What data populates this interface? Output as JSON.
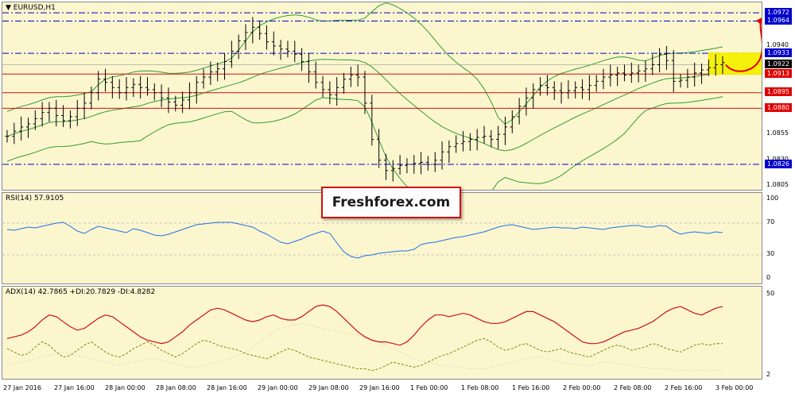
{
  "colors": {
    "bg": "#fcf6cf",
    "candle": "#000000",
    "bollinger": "#2e9e2e",
    "res_line": "#d01010",
    "blue_line": "#0000cc",
    "rsi": "#1e72e8",
    "adx": "#d01010",
    "plus_di": "#7a8a00",
    "minus_di": "#e0dcae",
    "highlight": "#f6f000",
    "arrow": "#e00000",
    "tag_blue": "#0000cc",
    "tag_red": "#e00000",
    "tag_black": "#000000"
  },
  "main": {
    "title": "▼ EURUSD,H1"
  },
  "rsi": {
    "title": "RSI(14) 57.9105",
    "ticks": [
      "100",
      "70",
      "30",
      "0"
    ]
  },
  "adx": {
    "title": "ADX(14) 42.7865 +DI:20.7829 -DI:4.8282",
    "ticks": [
      "50",
      "2"
    ]
  },
  "brand": {
    "label": "Freshforex.com"
  },
  "chart_data": [
    {
      "type": "line",
      "title": "EURUSD,H1",
      "x": [
        "27 Jan 2016",
        "27 Jan 16:00",
        "28 Jan 00:00",
        "28 Jan 08:00",
        "28 Jan 16:00",
        "29 Jan 00:00",
        "29 Jan 08:00",
        "29 Jan 16:00",
        "1 Feb 00:00",
        "1 Feb 08:00",
        "1 Feb 16:00",
        "2 Feb 00:00",
        "2 Feb 08:00",
        "2 Feb 16:00",
        "3 Feb 00:00"
      ],
      "ylim": [
        1.08,
        1.0982
      ],
      "price_ticks": [
        "1.0940",
        "1.0855",
        "1.0830",
        "1.0805"
      ],
      "levels": [
        {
          "value": 1.0972,
          "label": "1.0972",
          "style": "blue-dashdot"
        },
        {
          "value": 1.0964,
          "label": "1.0964",
          "style": "blue-dashdot"
        },
        {
          "value": 1.0933,
          "label": "1.0933",
          "style": "blue-dashdot"
        },
        {
          "value": 1.0922,
          "label": "1.0922",
          "style": "current-price"
        },
        {
          "value": 1.0913,
          "label": "1.0913",
          "style": "red-solid"
        },
        {
          "value": 1.0895,
          "label": "1.0895",
          "style": "red-solid"
        },
        {
          "value": 1.088,
          "label": "1.0880",
          "style": "red-solid"
        },
        {
          "value": 1.0826,
          "label": "1.0826",
          "style": "blue-dashdot"
        }
      ],
      "series": [
        {
          "values": [
            1.0853,
            1.0858,
            1.0862,
            1.0865,
            1.087,
            1.0876,
            1.088,
            1.0873,
            1.0868,
            1.0872,
            1.088,
            1.0885,
            1.0895,
            1.0908,
            1.0905,
            1.09,
            1.0895,
            1.09,
            1.0903,
            1.09,
            1.0898,
            1.0895,
            1.089,
            1.0886,
            1.0883,
            1.0888,
            1.0895,
            1.0905,
            1.091,
            1.0915,
            1.0918,
            1.0925,
            1.0935,
            1.0945,
            1.0953,
            1.0958,
            1.0952,
            1.0944,
            1.094,
            1.0937,
            1.0935,
            1.0932,
            1.0925,
            1.0915,
            1.0905,
            1.0898,
            1.0893,
            1.09,
            1.0908,
            1.0912,
            1.091,
            1.0885,
            1.085,
            1.083,
            1.082,
            1.0822,
            1.0825,
            1.0826,
            1.0827,
            1.0828,
            1.0826,
            1.083,
            1.0838,
            1.0843,
            1.0846,
            1.0848,
            1.085,
            1.0852,
            1.0853,
            1.085,
            1.0855,
            1.0862,
            1.0872,
            1.0882,
            1.089,
            1.0898,
            1.0902,
            1.09,
            1.0897,
            1.0895,
            1.0897,
            1.09,
            1.0898,
            1.0902,
            1.0906,
            1.091,
            1.0912,
            1.0914,
            1.0912,
            1.0914,
            1.0916,
            1.0918,
            1.0922,
            1.0932,
            1.0926,
            1.0906,
            1.0907,
            1.091,
            1.0914,
            1.0917,
            1.0919,
            1.0922,
            1.0924
          ]
        },
        {
          "name": "RSI(14)",
          "values": [
            62,
            61,
            63,
            65,
            64,
            66,
            68,
            70,
            71,
            66,
            60,
            57,
            62,
            66,
            64,
            62,
            60,
            58,
            63,
            61,
            58,
            55,
            54,
            56,
            59,
            62,
            65,
            68,
            69,
            70,
            71,
            71,
            71,
            69,
            67,
            65,
            60,
            56,
            51,
            46,
            44,
            47,
            50,
            54,
            57,
            60,
            57,
            45,
            34,
            28,
            26,
            29,
            30,
            32,
            33,
            34,
            35,
            35,
            37,
            43,
            45,
            46,
            48,
            50,
            52,
            53,
            55,
            57,
            59,
            62,
            65,
            67,
            68,
            66,
            64,
            62,
            63,
            64,
            65,
            64,
            64,
            63,
            65,
            64,
            63,
            62,
            64,
            65,
            66,
            67,
            67,
            65,
            65,
            67,
            66,
            60,
            56,
            58,
            59,
            58,
            57,
            59,
            58
          ]
        },
        {
          "name": "ADX(14)",
          "values": [
            24,
            25,
            26,
            28,
            31,
            35,
            38,
            37,
            34,
            31,
            29,
            30,
            33,
            36,
            38,
            37,
            34,
            31,
            28,
            25,
            23,
            22,
            21,
            22,
            25,
            28,
            32,
            35,
            38,
            41,
            42,
            41,
            39,
            37,
            35,
            34,
            35,
            37,
            38,
            36,
            35,
            35,
            37,
            40,
            43,
            44,
            43,
            40,
            36,
            32,
            28,
            25,
            23,
            22,
            22,
            21,
            20,
            22,
            26,
            31,
            35,
            38,
            38,
            37,
            38,
            39,
            38,
            36,
            34,
            33,
            33,
            34,
            36,
            38,
            40,
            40,
            38,
            36,
            34,
            31,
            28,
            25,
            22,
            21,
            21,
            22,
            24,
            26,
            28,
            29,
            30,
            32,
            34,
            37,
            40,
            42,
            43,
            41,
            39,
            38,
            40,
            42,
            43
          ]
        },
        {
          "name": "+DI",
          "values": [
            18,
            16,
            14,
            15,
            19,
            22,
            20,
            16,
            13,
            14,
            17,
            20,
            22,
            19,
            16,
            14,
            13,
            15,
            18,
            20,
            22,
            20,
            17,
            15,
            13,
            15,
            18,
            21,
            23,
            22,
            20,
            19,
            18,
            17,
            15,
            14,
            13,
            12,
            14,
            16,
            18,
            17,
            15,
            13,
            12,
            11,
            10,
            9,
            8,
            7,
            6,
            6,
            5,
            6,
            8,
            10,
            9,
            8,
            7,
            8,
            10,
            12,
            14,
            15,
            17,
            19,
            21,
            23,
            24,
            22,
            19,
            17,
            18,
            20,
            21,
            19,
            17,
            16,
            17,
            18,
            16,
            15,
            14,
            13,
            15,
            17,
            19,
            20,
            19,
            17,
            18,
            19,
            21,
            20,
            18,
            17,
            16,
            18,
            20,
            21,
            20,
            21,
            21
          ]
        },
        {
          "name": "-DI",
          "values": [
            8,
            9,
            10,
            11,
            12,
            13,
            14,
            15,
            16,
            15,
            14,
            13,
            12,
            11,
            10,
            9,
            8,
            9,
            10,
            11,
            12,
            12,
            11,
            10,
            9,
            8,
            7,
            7,
            8,
            9,
            10,
            11,
            12,
            14,
            16,
            19,
            22,
            25,
            28,
            30,
            31,
            32,
            33,
            32,
            31,
            30,
            29,
            28,
            27,
            27,
            26,
            25,
            24,
            22,
            20,
            18,
            16,
            14,
            12,
            11,
            10,
            9,
            8,
            8,
            7,
            7,
            6,
            6,
            6,
            7,
            8,
            9,
            10,
            11,
            12,
            13,
            13,
            12,
            11,
            10,
            9,
            9,
            8,
            8,
            9,
            10,
            10,
            9,
            9,
            8,
            7,
            7,
            6,
            6,
            6,
            5,
            5,
            5,
            5,
            5,
            5,
            5,
            5
          ]
        }
      ]
    }
  ]
}
